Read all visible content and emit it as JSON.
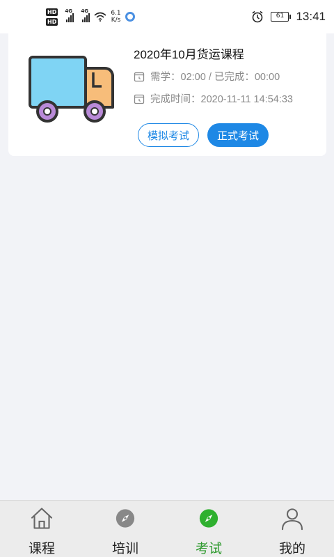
{
  "status_bar": {
    "hd_top": "HD",
    "hd_bottom": "HD",
    "net1": "4G",
    "net2": "4G",
    "speed_value": "6.1",
    "speed_unit": "K/s",
    "battery": "61",
    "time": "13:41"
  },
  "course": {
    "title": "2020年10月货运课程",
    "study_info": "需学：02:00 / 已完成：00:00",
    "completed_time": "完成时间：2020-11-11 14:54:33",
    "mock_exam_label": "模拟考试",
    "formal_exam_label": "正式考试",
    "icon": "truck-illustration"
  },
  "bottom_nav": {
    "items": [
      {
        "label": "课程",
        "icon": "home-icon"
      },
      {
        "label": "培训",
        "icon": "compass-icon"
      },
      {
        "label": "考试",
        "icon": "compass-icon"
      },
      {
        "label": "我的",
        "icon": "user-icon"
      }
    ],
    "active_index": 2
  },
  "colors": {
    "accent_blue": "#1e88e5",
    "active_green": "#2e9a2e",
    "background": "#f2f3f7"
  }
}
